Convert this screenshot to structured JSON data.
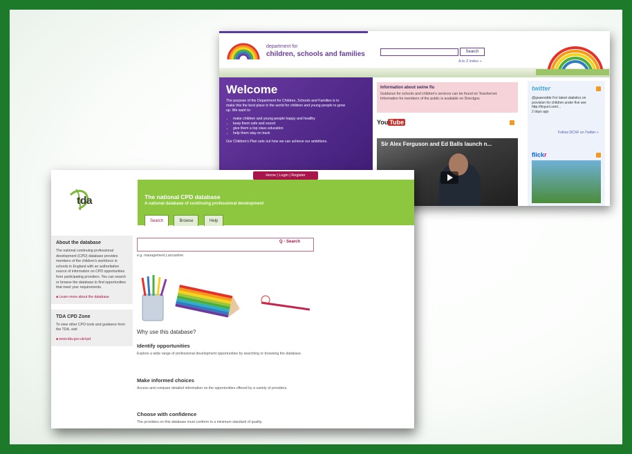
{
  "dcsf": {
    "brand_line1": "department for",
    "brand_line2": "children, schools and families",
    "search_button": "Search",
    "a_to_z": "A to Z index »",
    "welcome_heading": "Welcome",
    "welcome_text": "The purpose of the Department for Children, Schools and Families is to make this the best place in the world for children and young people to grow up. We want to:",
    "welcome_bullets": [
      "make children and young people happy and healthy",
      "keep them safe and sound",
      "give them a top class education",
      "help them stay on track"
    ],
    "welcome_tail": "Our Children's Plan sets out how we can achieve our ambitions.",
    "flu_title": "Information about swine flu",
    "flu_text": "Guidance for schools and children's services can be found on Teachernet. Information for members of the public is available on Directgov.",
    "youtube_you": "You",
    "youtube_tube": "Tube",
    "video_title": "Sir Alex Ferguson and Ed Balls launch n...",
    "twitter_title": "twitter",
    "twitter_text": "@gsaerodde For latest statistics on provision for children under five see http://tinyurl.com/...",
    "twitter_time": "2 days ago",
    "twitter_follow": "Follow DCSF on Twitter »",
    "flickr_a": "flick",
    "flickr_b": "r"
  },
  "tda": {
    "logo_text": "tda",
    "nav_links": "Home  |  Login  |  Register",
    "title": "The national CPD database",
    "subtitle": "A national database of continuing professional development",
    "tabs": [
      "Search",
      "Browse",
      "Help"
    ],
    "search_button": "Q - Search",
    "search_example": "e.g. management,Lancashire",
    "about_heading": "About the database",
    "about_text": "The national continuing professional development (CPD) database provides members of the children's workforce in schools in England with an authoritative source of information on CPD opportunities from participating providers. You can search or browse the database to find opportunities that meet your requirements.",
    "about_link": "Learn more about the database",
    "zone_heading": "TDA CPD Zone",
    "zone_text": "To view other CPD tools and guidance from the TDA, visit",
    "zone_link": "www.tda.gov.uk/cpd",
    "why_heading": "Why use this database?",
    "features": [
      {
        "title": "Identify opportunities",
        "text": "Explore a wide range of professional development opportunities by searching or browsing the database."
      },
      {
        "title": "Make informed choices",
        "text": "Access and compare detailed information on the opportunities offered by a variety of providers."
      },
      {
        "title": "Choose with confidence",
        "text": "The providers on this database must conform to a minimum standard of quality."
      }
    ]
  },
  "colors": {
    "frame_green": "#1d7a2a",
    "dcsf_purple": "#5a3a9a",
    "tda_green": "#8dc63f",
    "tda_accent": "#a8154a"
  }
}
